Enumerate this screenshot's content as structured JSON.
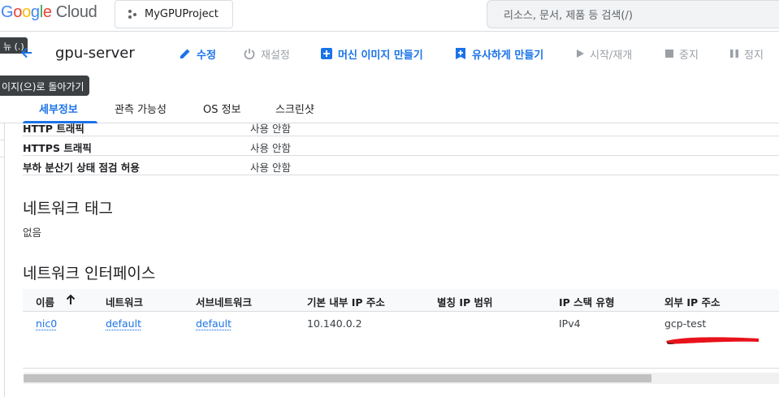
{
  "header": {
    "project_label": "MyGPUProject",
    "search_placeholder": "리소스, 문서, 제품 등 검색(/)"
  },
  "left_badge": "뉴 (.)",
  "page": {
    "title": "gpu-server",
    "back_tooltip": "이지(으)로 돌아가기"
  },
  "toolbar": {
    "edit": "수정",
    "reset": "재설정",
    "create_image": "머신 이미지 만들기",
    "create_similar": "유사하게 만들기",
    "start": "시작/재개",
    "stop": "중지",
    "suspend": "정지"
  },
  "tabs": [
    "세부정보",
    "관측 가능성",
    "OS 정보",
    "스크린샷"
  ],
  "firewall_rows": [
    {
      "key": "HTTP 트래픽",
      "value": "사용 안함"
    },
    {
      "key": "HTTPS 트래픽",
      "value": "사용 안함"
    },
    {
      "key": "부하 분산기 상태 점검 허용",
      "value": "사용 안함"
    }
  ],
  "network_tags": {
    "heading": "네트워크 태그",
    "value": "없음"
  },
  "network_interfaces": {
    "heading": "네트워크 인터페이스",
    "columns": [
      "이름",
      "네트워크",
      "서브네트워크",
      "기본 내부 IP 주소",
      "별칭 IP 범위",
      "IP 스택 유형",
      "외부 IP 주소"
    ],
    "rows": [
      {
        "name": "nic0",
        "network": "default",
        "subnetwork": "default",
        "internal_ip": "10.140.0.2",
        "alias": "",
        "stack": "IPv4",
        "external_ip": "gcp-test"
      }
    ]
  },
  "colors": {
    "accent": "#1a73e8",
    "redaction": "#e8121b"
  }
}
